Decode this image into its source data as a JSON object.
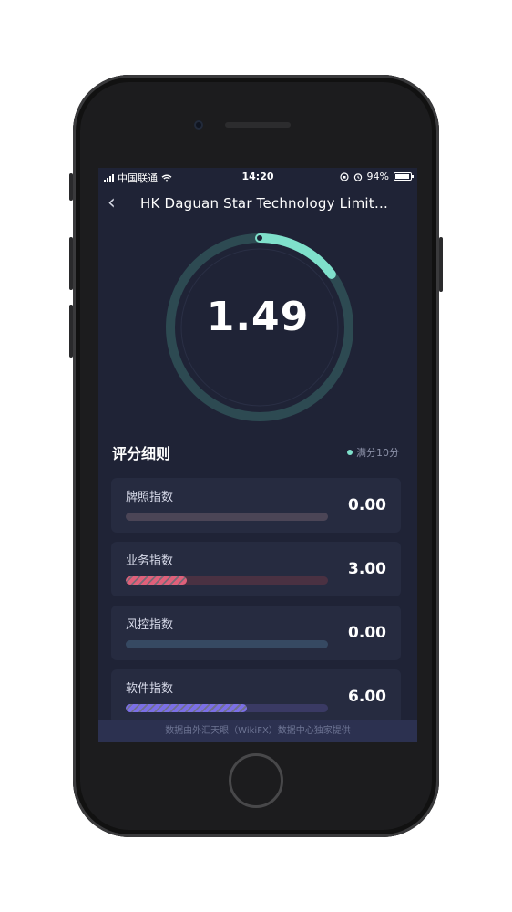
{
  "status_bar": {
    "carrier": "中国联通",
    "time": "14:20",
    "battery": "94%"
  },
  "header": {
    "back_icon": "chevron-left-icon",
    "title": "HK Daguan Star Technology Limite..."
  },
  "rating": {
    "score": "1.49",
    "max": 10,
    "gauge_fraction": 0.149
  },
  "section": {
    "title": "评分细则",
    "full_score_note": "满分10分"
  },
  "metrics": [
    {
      "label": "牌照指数",
      "value": "0.00",
      "fraction": 0.0,
      "track_color": "#4b4556",
      "fill_color": "#e0607a"
    },
    {
      "label": "业务指数",
      "value": "3.00",
      "fraction": 0.3,
      "track_color": "#4a3142",
      "fill_color": "#e0607a"
    },
    {
      "label": "风控指数",
      "value": "0.00",
      "fraction": 0.0,
      "track_color": "#364962",
      "fill_color": "#5fa0e0"
    },
    {
      "label": "软件指数",
      "value": "6.00",
      "fraction": 0.6,
      "track_color": "#3a3a64",
      "fill_color": "#7b6fe6"
    }
  ],
  "footer": {
    "text": "数据由外汇天眼（WikiFX）数据中心独家提供"
  },
  "colors": {
    "background": "#1f2336",
    "card": "#262b40",
    "gauge_track": "#2d4a52",
    "gauge_progress": "#7fe0cb"
  }
}
